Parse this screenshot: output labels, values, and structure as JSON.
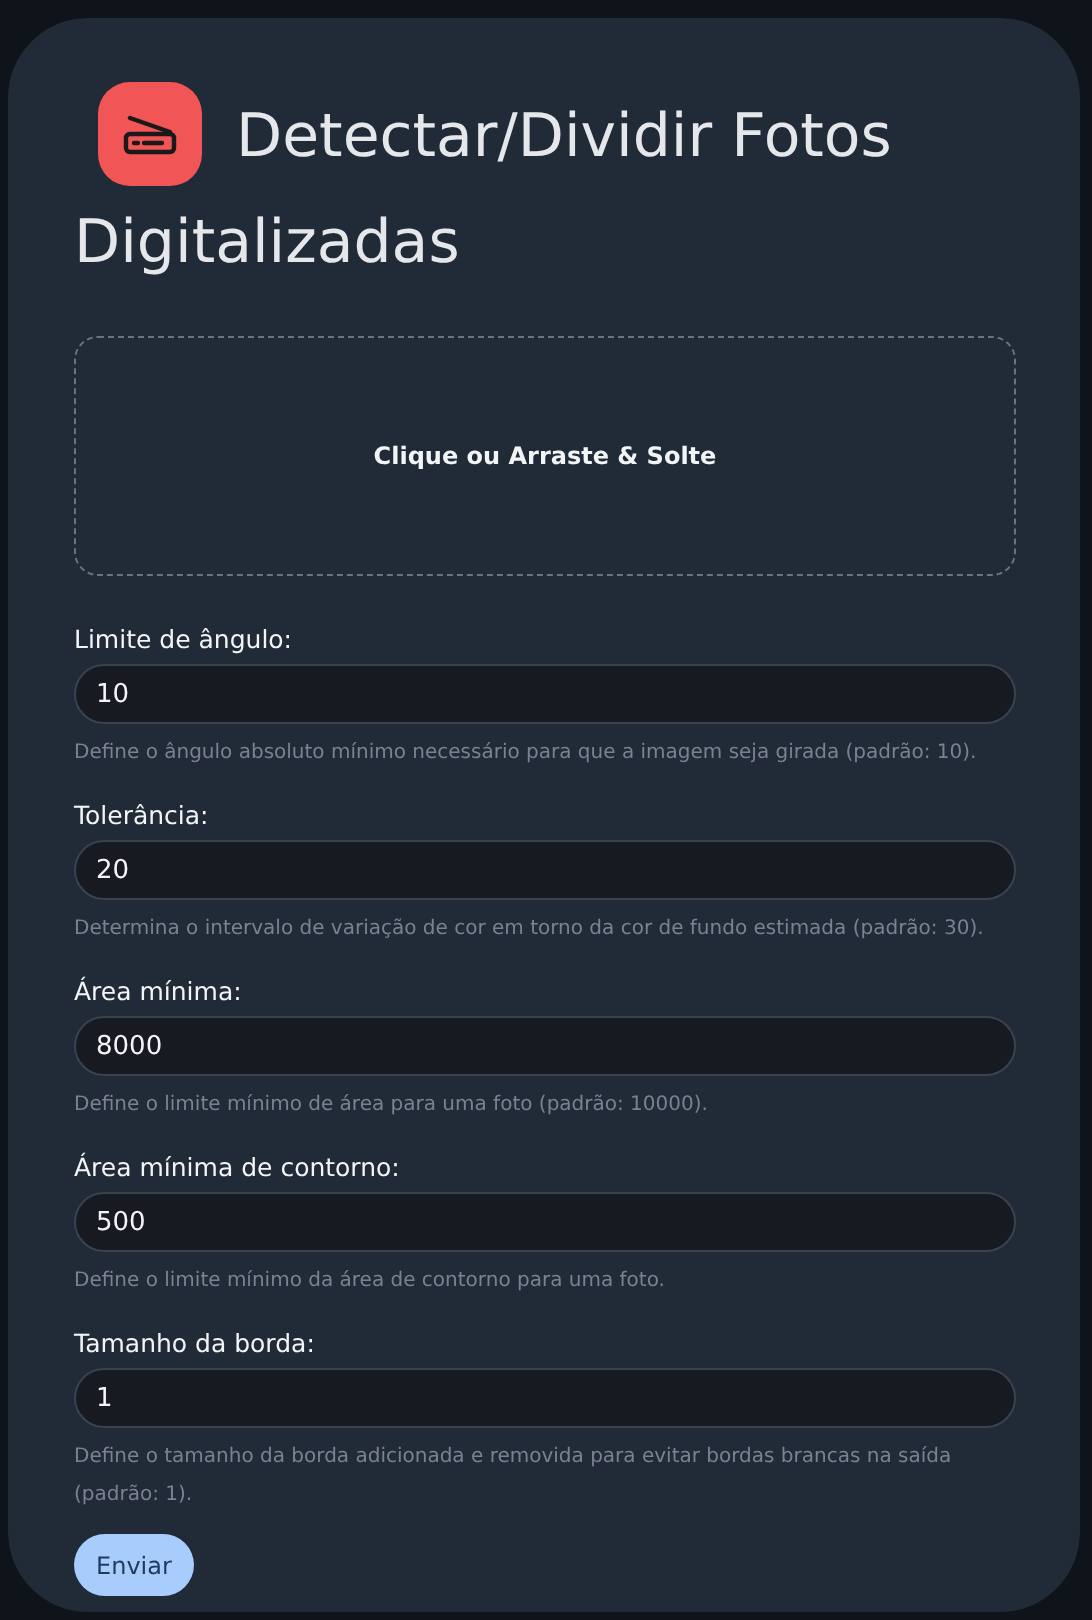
{
  "title": "Detectar/Dividir Fotos Digitalizadas",
  "dropzone": {
    "label": "Clique ou Arraste & Solte"
  },
  "fields": [
    {
      "label": "Limite de ângulo:",
      "value": "10",
      "help": "Define o ângulo absoluto mínimo necessário para que a imagem seja girada (padrão: 10)."
    },
    {
      "label": "Tolerância:",
      "value": "20",
      "help": "Determina o intervalo de variação de cor em torno da cor de fundo estimada (padrão: 30)."
    },
    {
      "label": "Área mínima:",
      "value": "8000",
      "help": "Define o limite mínimo de área para uma foto (padrão: 10000)."
    },
    {
      "label": "Área mínima de contorno:",
      "value": "500",
      "help": "Define o limite mínimo da área de contorno para uma foto."
    },
    {
      "label": "Tamanho da borda:",
      "value": "1",
      "help": "Define o tamanho da borda adicionada e removida para evitar bordas brancas na saída (padrão: 1)."
    }
  ],
  "submit": "Enviar"
}
